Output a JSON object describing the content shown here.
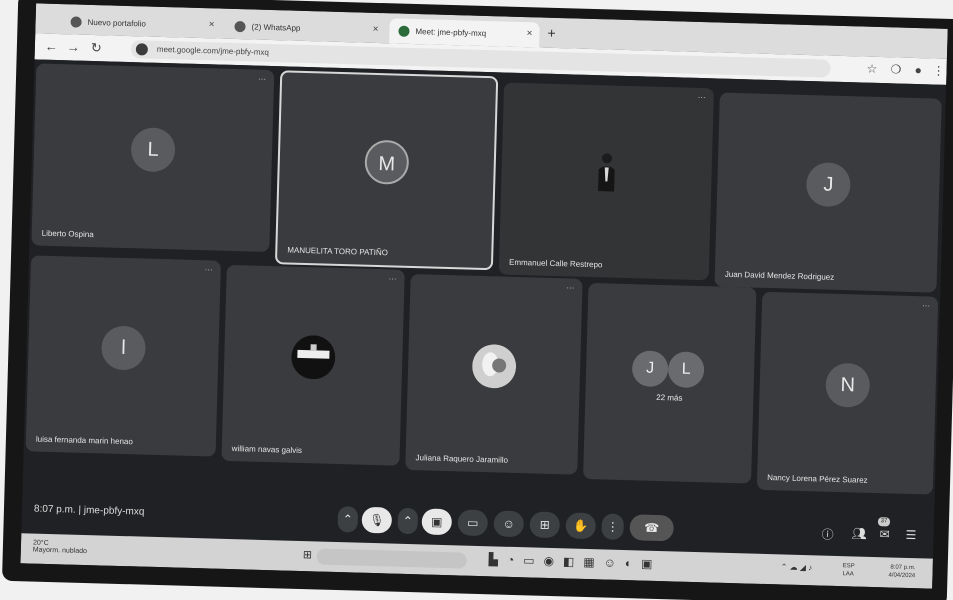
{
  "browser": {
    "tabs": [
      {
        "label": "Nuevo portafolio"
      },
      {
        "label": "(2) WhatsApp"
      },
      {
        "label": "Meet: jme-pbfy-mxq",
        "active": true
      }
    ],
    "url": "meet.google.com/jme-pbfy-mxq"
  },
  "meet": {
    "participants_top": [
      {
        "name": "Liberto Ospina",
        "initial": "L",
        "avatar": "letter"
      },
      {
        "name": "MANUELITA TORO PATIÑO",
        "initial": "M",
        "avatar": "letter",
        "speaking": true
      },
      {
        "name": "Emmanuel Calle Restrepo",
        "initial": "",
        "avatar": "video"
      },
      {
        "name": "Juan David Mendez Rodriguez",
        "initial": "J",
        "avatar": "letter"
      }
    ],
    "participants_bottom": [
      {
        "name": "luisa fernanda marin henao",
        "initial": "l",
        "avatar": "letter"
      },
      {
        "name": "william navas galvis",
        "initial": "",
        "avatar": "photo"
      },
      {
        "name": "Juliana Raquero Jaramillo",
        "initial": "",
        "avatar": "photo"
      },
      {
        "name": "",
        "initial": "",
        "avatar": "more"
      },
      {
        "name": "Nancy Lorena Pérez Suarez",
        "initial": "N",
        "avatar": "letter"
      }
    ],
    "more": {
      "initials": [
        "J",
        "L"
      ],
      "count_label": "22 más"
    }
  },
  "controls": {
    "time": "8:07 p.m.",
    "meeting_code": "jme-pbfy-mxq",
    "participant_badge": "37"
  },
  "taskbar": {
    "weather_line1": "20°C",
    "weather_line2": "Mayorm. nublado",
    "lang_line1": "ESP",
    "lang_line2": "LAA",
    "time_line1": "8:07 p.m.",
    "time_line2": "4/04/2024"
  },
  "colors": {
    "tile": "#3a3b3e",
    "background": "#202124",
    "speaking_border": "#d8d8d8"
  }
}
